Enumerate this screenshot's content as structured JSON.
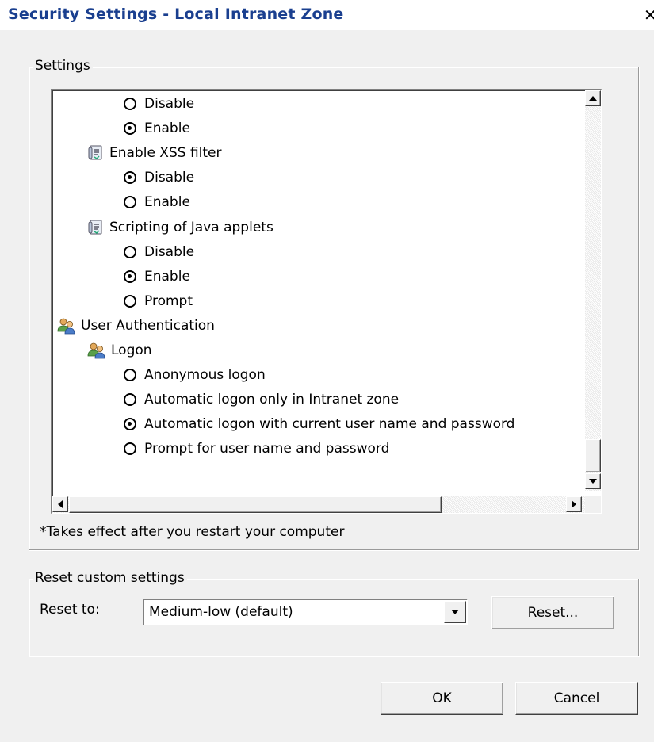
{
  "window": {
    "title": "Security Settings - Local Intranet Zone",
    "close_glyph": "✕"
  },
  "settings_group": {
    "legend": "Settings",
    "tree": [
      {
        "kind": "radio",
        "label": "Disable",
        "checked": false,
        "indent": 1
      },
      {
        "kind": "radio",
        "label": "Enable",
        "checked": true,
        "indent": 1
      },
      {
        "kind": "script",
        "label": "Enable XSS filter",
        "indent": 0.5,
        "icon": "script-settings-icon"
      },
      {
        "kind": "radio",
        "label": "Disable",
        "checked": true,
        "indent": 1
      },
      {
        "kind": "radio",
        "label": "Enable",
        "checked": false,
        "indent": 1
      },
      {
        "kind": "script",
        "label": "Scripting of Java applets",
        "indent": 0.5,
        "icon": "script-settings-icon"
      },
      {
        "kind": "radio",
        "label": "Disable",
        "checked": false,
        "indent": 1
      },
      {
        "kind": "radio",
        "label": "Enable",
        "checked": true,
        "indent": 1
      },
      {
        "kind": "radio",
        "label": "Prompt",
        "checked": false,
        "indent": 1
      },
      {
        "kind": "users",
        "label": "User Authentication",
        "indent": 0,
        "icon": "users-icon"
      },
      {
        "kind": "users",
        "label": "Logon",
        "indent": 0.5,
        "icon": "users-icon"
      },
      {
        "kind": "radio",
        "label": "Anonymous logon",
        "checked": false,
        "indent": 1
      },
      {
        "kind": "radio",
        "label": "Automatic logon only in Intranet zone",
        "checked": false,
        "indent": 1
      },
      {
        "kind": "radio",
        "label": "Automatic logon with current user name and password",
        "checked": true,
        "indent": 1
      },
      {
        "kind": "radio",
        "label": "Prompt for user name and password",
        "checked": false,
        "indent": 1
      }
    ],
    "note": "*Takes effect after you restart your computer"
  },
  "reset_group": {
    "legend": "Reset custom settings",
    "reset_to_label": "Reset to:",
    "selected_level": "Medium-low (default)",
    "reset_button": "Reset..."
  },
  "footer": {
    "ok_button": "OK",
    "cancel_button": "Cancel"
  },
  "colors": {
    "title_text": "#1a3f8f",
    "dialog_bg": "#f0f0f0",
    "list_bg": "#ffffff"
  }
}
